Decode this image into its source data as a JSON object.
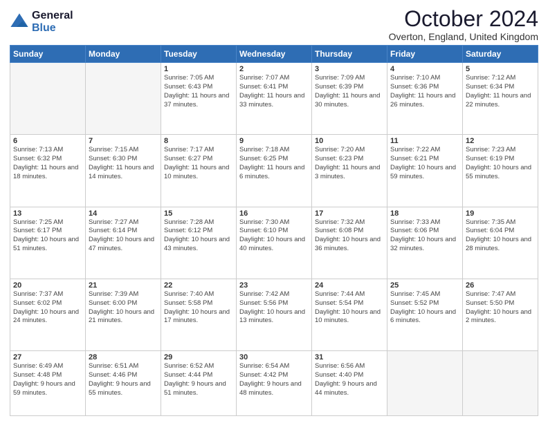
{
  "logo": {
    "general": "General",
    "blue": "Blue"
  },
  "header": {
    "title": "October 2024",
    "subtitle": "Overton, England, United Kingdom"
  },
  "weekdays": [
    "Sunday",
    "Monday",
    "Tuesday",
    "Wednesday",
    "Thursday",
    "Friday",
    "Saturday"
  ],
  "weeks": [
    [
      {
        "day": "",
        "info": ""
      },
      {
        "day": "",
        "info": ""
      },
      {
        "day": "1",
        "info": "Sunrise: 7:05 AM\nSunset: 6:43 PM\nDaylight: 11 hours and 37 minutes."
      },
      {
        "day": "2",
        "info": "Sunrise: 7:07 AM\nSunset: 6:41 PM\nDaylight: 11 hours and 33 minutes."
      },
      {
        "day": "3",
        "info": "Sunrise: 7:09 AM\nSunset: 6:39 PM\nDaylight: 11 hours and 30 minutes."
      },
      {
        "day": "4",
        "info": "Sunrise: 7:10 AM\nSunset: 6:36 PM\nDaylight: 11 hours and 26 minutes."
      },
      {
        "day": "5",
        "info": "Sunrise: 7:12 AM\nSunset: 6:34 PM\nDaylight: 11 hours and 22 minutes."
      }
    ],
    [
      {
        "day": "6",
        "info": "Sunrise: 7:13 AM\nSunset: 6:32 PM\nDaylight: 11 hours and 18 minutes."
      },
      {
        "day": "7",
        "info": "Sunrise: 7:15 AM\nSunset: 6:30 PM\nDaylight: 11 hours and 14 minutes."
      },
      {
        "day": "8",
        "info": "Sunrise: 7:17 AM\nSunset: 6:27 PM\nDaylight: 11 hours and 10 minutes."
      },
      {
        "day": "9",
        "info": "Sunrise: 7:18 AM\nSunset: 6:25 PM\nDaylight: 11 hours and 6 minutes."
      },
      {
        "day": "10",
        "info": "Sunrise: 7:20 AM\nSunset: 6:23 PM\nDaylight: 11 hours and 3 minutes."
      },
      {
        "day": "11",
        "info": "Sunrise: 7:22 AM\nSunset: 6:21 PM\nDaylight: 10 hours and 59 minutes."
      },
      {
        "day": "12",
        "info": "Sunrise: 7:23 AM\nSunset: 6:19 PM\nDaylight: 10 hours and 55 minutes."
      }
    ],
    [
      {
        "day": "13",
        "info": "Sunrise: 7:25 AM\nSunset: 6:17 PM\nDaylight: 10 hours and 51 minutes."
      },
      {
        "day": "14",
        "info": "Sunrise: 7:27 AM\nSunset: 6:14 PM\nDaylight: 10 hours and 47 minutes."
      },
      {
        "day": "15",
        "info": "Sunrise: 7:28 AM\nSunset: 6:12 PM\nDaylight: 10 hours and 43 minutes."
      },
      {
        "day": "16",
        "info": "Sunrise: 7:30 AM\nSunset: 6:10 PM\nDaylight: 10 hours and 40 minutes."
      },
      {
        "day": "17",
        "info": "Sunrise: 7:32 AM\nSunset: 6:08 PM\nDaylight: 10 hours and 36 minutes."
      },
      {
        "day": "18",
        "info": "Sunrise: 7:33 AM\nSunset: 6:06 PM\nDaylight: 10 hours and 32 minutes."
      },
      {
        "day": "19",
        "info": "Sunrise: 7:35 AM\nSunset: 6:04 PM\nDaylight: 10 hours and 28 minutes."
      }
    ],
    [
      {
        "day": "20",
        "info": "Sunrise: 7:37 AM\nSunset: 6:02 PM\nDaylight: 10 hours and 24 minutes."
      },
      {
        "day": "21",
        "info": "Sunrise: 7:39 AM\nSunset: 6:00 PM\nDaylight: 10 hours and 21 minutes."
      },
      {
        "day": "22",
        "info": "Sunrise: 7:40 AM\nSunset: 5:58 PM\nDaylight: 10 hours and 17 minutes."
      },
      {
        "day": "23",
        "info": "Sunrise: 7:42 AM\nSunset: 5:56 PM\nDaylight: 10 hours and 13 minutes."
      },
      {
        "day": "24",
        "info": "Sunrise: 7:44 AM\nSunset: 5:54 PM\nDaylight: 10 hours and 10 minutes."
      },
      {
        "day": "25",
        "info": "Sunrise: 7:45 AM\nSunset: 5:52 PM\nDaylight: 10 hours and 6 minutes."
      },
      {
        "day": "26",
        "info": "Sunrise: 7:47 AM\nSunset: 5:50 PM\nDaylight: 10 hours and 2 minutes."
      }
    ],
    [
      {
        "day": "27",
        "info": "Sunrise: 6:49 AM\nSunset: 4:48 PM\nDaylight: 9 hours and 59 minutes."
      },
      {
        "day": "28",
        "info": "Sunrise: 6:51 AM\nSunset: 4:46 PM\nDaylight: 9 hours and 55 minutes."
      },
      {
        "day": "29",
        "info": "Sunrise: 6:52 AM\nSunset: 4:44 PM\nDaylight: 9 hours and 51 minutes."
      },
      {
        "day": "30",
        "info": "Sunrise: 6:54 AM\nSunset: 4:42 PM\nDaylight: 9 hours and 48 minutes."
      },
      {
        "day": "31",
        "info": "Sunrise: 6:56 AM\nSunset: 4:40 PM\nDaylight: 9 hours and 44 minutes."
      },
      {
        "day": "",
        "info": ""
      },
      {
        "day": "",
        "info": ""
      }
    ]
  ]
}
